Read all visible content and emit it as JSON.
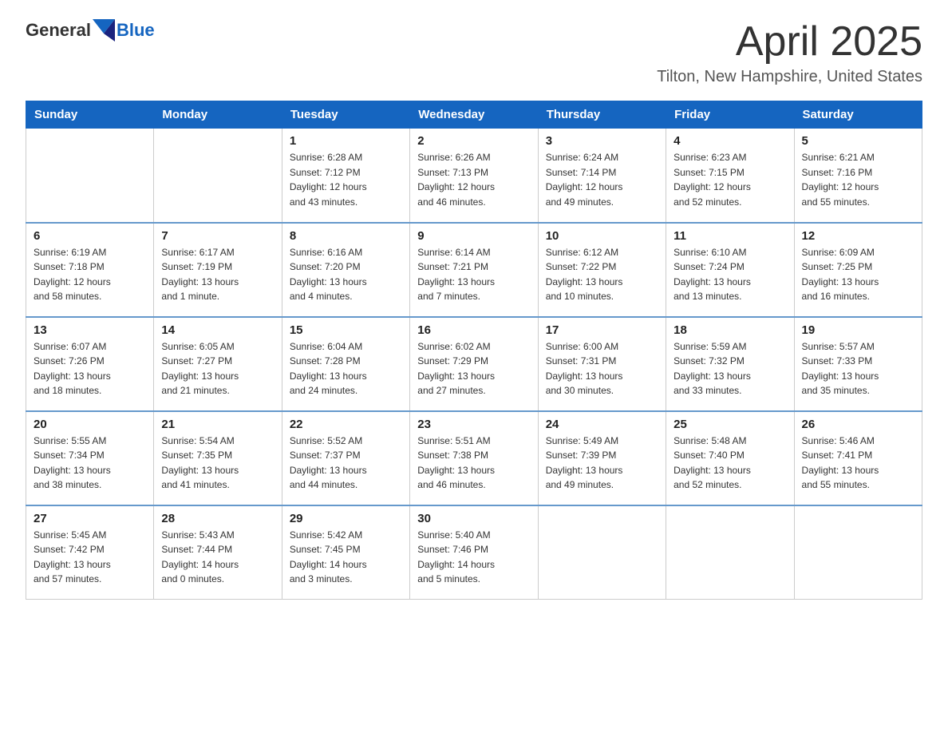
{
  "header": {
    "logo_general": "General",
    "logo_blue": "Blue",
    "month_title": "April 2025",
    "location": "Tilton, New Hampshire, United States"
  },
  "days_of_week": [
    "Sunday",
    "Monday",
    "Tuesday",
    "Wednesday",
    "Thursday",
    "Friday",
    "Saturday"
  ],
  "weeks": [
    [
      {
        "day": "",
        "info": ""
      },
      {
        "day": "",
        "info": ""
      },
      {
        "day": "1",
        "info": "Sunrise: 6:28 AM\nSunset: 7:12 PM\nDaylight: 12 hours\nand 43 minutes."
      },
      {
        "day": "2",
        "info": "Sunrise: 6:26 AM\nSunset: 7:13 PM\nDaylight: 12 hours\nand 46 minutes."
      },
      {
        "day": "3",
        "info": "Sunrise: 6:24 AM\nSunset: 7:14 PM\nDaylight: 12 hours\nand 49 minutes."
      },
      {
        "day": "4",
        "info": "Sunrise: 6:23 AM\nSunset: 7:15 PM\nDaylight: 12 hours\nand 52 minutes."
      },
      {
        "day": "5",
        "info": "Sunrise: 6:21 AM\nSunset: 7:16 PM\nDaylight: 12 hours\nand 55 minutes."
      }
    ],
    [
      {
        "day": "6",
        "info": "Sunrise: 6:19 AM\nSunset: 7:18 PM\nDaylight: 12 hours\nand 58 minutes."
      },
      {
        "day": "7",
        "info": "Sunrise: 6:17 AM\nSunset: 7:19 PM\nDaylight: 13 hours\nand 1 minute."
      },
      {
        "day": "8",
        "info": "Sunrise: 6:16 AM\nSunset: 7:20 PM\nDaylight: 13 hours\nand 4 minutes."
      },
      {
        "day": "9",
        "info": "Sunrise: 6:14 AM\nSunset: 7:21 PM\nDaylight: 13 hours\nand 7 minutes."
      },
      {
        "day": "10",
        "info": "Sunrise: 6:12 AM\nSunset: 7:22 PM\nDaylight: 13 hours\nand 10 minutes."
      },
      {
        "day": "11",
        "info": "Sunrise: 6:10 AM\nSunset: 7:24 PM\nDaylight: 13 hours\nand 13 minutes."
      },
      {
        "day": "12",
        "info": "Sunrise: 6:09 AM\nSunset: 7:25 PM\nDaylight: 13 hours\nand 16 minutes."
      }
    ],
    [
      {
        "day": "13",
        "info": "Sunrise: 6:07 AM\nSunset: 7:26 PM\nDaylight: 13 hours\nand 18 minutes."
      },
      {
        "day": "14",
        "info": "Sunrise: 6:05 AM\nSunset: 7:27 PM\nDaylight: 13 hours\nand 21 minutes."
      },
      {
        "day": "15",
        "info": "Sunrise: 6:04 AM\nSunset: 7:28 PM\nDaylight: 13 hours\nand 24 minutes."
      },
      {
        "day": "16",
        "info": "Sunrise: 6:02 AM\nSunset: 7:29 PM\nDaylight: 13 hours\nand 27 minutes."
      },
      {
        "day": "17",
        "info": "Sunrise: 6:00 AM\nSunset: 7:31 PM\nDaylight: 13 hours\nand 30 minutes."
      },
      {
        "day": "18",
        "info": "Sunrise: 5:59 AM\nSunset: 7:32 PM\nDaylight: 13 hours\nand 33 minutes."
      },
      {
        "day": "19",
        "info": "Sunrise: 5:57 AM\nSunset: 7:33 PM\nDaylight: 13 hours\nand 35 minutes."
      }
    ],
    [
      {
        "day": "20",
        "info": "Sunrise: 5:55 AM\nSunset: 7:34 PM\nDaylight: 13 hours\nand 38 minutes."
      },
      {
        "day": "21",
        "info": "Sunrise: 5:54 AM\nSunset: 7:35 PM\nDaylight: 13 hours\nand 41 minutes."
      },
      {
        "day": "22",
        "info": "Sunrise: 5:52 AM\nSunset: 7:37 PM\nDaylight: 13 hours\nand 44 minutes."
      },
      {
        "day": "23",
        "info": "Sunrise: 5:51 AM\nSunset: 7:38 PM\nDaylight: 13 hours\nand 46 minutes."
      },
      {
        "day": "24",
        "info": "Sunrise: 5:49 AM\nSunset: 7:39 PM\nDaylight: 13 hours\nand 49 minutes."
      },
      {
        "day": "25",
        "info": "Sunrise: 5:48 AM\nSunset: 7:40 PM\nDaylight: 13 hours\nand 52 minutes."
      },
      {
        "day": "26",
        "info": "Sunrise: 5:46 AM\nSunset: 7:41 PM\nDaylight: 13 hours\nand 55 minutes."
      }
    ],
    [
      {
        "day": "27",
        "info": "Sunrise: 5:45 AM\nSunset: 7:42 PM\nDaylight: 13 hours\nand 57 minutes."
      },
      {
        "day": "28",
        "info": "Sunrise: 5:43 AM\nSunset: 7:44 PM\nDaylight: 14 hours\nand 0 minutes."
      },
      {
        "day": "29",
        "info": "Sunrise: 5:42 AM\nSunset: 7:45 PM\nDaylight: 14 hours\nand 3 minutes."
      },
      {
        "day": "30",
        "info": "Sunrise: 5:40 AM\nSunset: 7:46 PM\nDaylight: 14 hours\nand 5 minutes."
      },
      {
        "day": "",
        "info": ""
      },
      {
        "day": "",
        "info": ""
      },
      {
        "day": "",
        "info": ""
      }
    ]
  ]
}
